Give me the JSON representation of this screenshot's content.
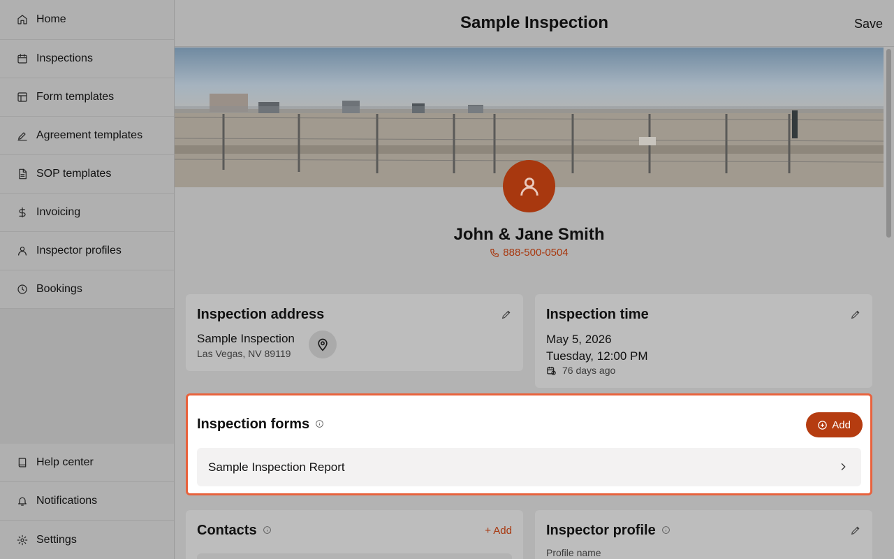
{
  "sidebar": {
    "top_items": [
      {
        "label": "Home",
        "icon": "home-icon"
      },
      {
        "label": "Inspections",
        "icon": "calendar-icon"
      },
      {
        "label": "Form templates",
        "icon": "layout-icon"
      },
      {
        "label": "Agreement templates",
        "icon": "signature-icon"
      },
      {
        "label": "SOP templates",
        "icon": "document-icon"
      },
      {
        "label": "Invoicing",
        "icon": "dollar-icon"
      },
      {
        "label": "Inspector profiles",
        "icon": "user-icon"
      },
      {
        "label": "Bookings",
        "icon": "clock-icon"
      }
    ],
    "bottom_items": [
      {
        "label": "Help center",
        "icon": "book-icon"
      },
      {
        "label": "Notifications",
        "icon": "bell-icon"
      },
      {
        "label": "Settings",
        "icon": "gear-icon"
      }
    ]
  },
  "header": {
    "title": "Sample Inspection",
    "save_label": "Save"
  },
  "client": {
    "name": "John & Jane Smith",
    "phone": "888-500-0504"
  },
  "address_card": {
    "title": "Inspection address",
    "name": "Sample Inspection",
    "city": "Las Vegas, NV 89119"
  },
  "time_card": {
    "title": "Inspection time",
    "date": "May 5, 2026",
    "day_time": "Tuesday, 12:00 PM",
    "relative": "76 days ago"
  },
  "forms_card": {
    "title": "Inspection forms",
    "add_label": "Add",
    "items": [
      {
        "label": "Sample Inspection Report"
      }
    ]
  },
  "contacts_card": {
    "title": "Contacts",
    "add_label": "+ Add"
  },
  "inspector_card": {
    "title": "Inspector profile",
    "profile_label": "Profile name"
  },
  "colors": {
    "accent": "#b53c10",
    "highlight_border": "#e8623d"
  }
}
